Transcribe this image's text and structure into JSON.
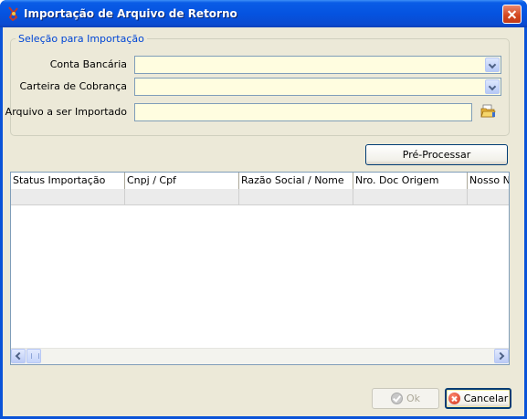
{
  "window": {
    "title": "Importação de Arquivo de Retorno",
    "icon": "app-logo-icon"
  },
  "selection": {
    "legend": "Seleção para Importação",
    "conta_bancaria_label": "Conta Bancária",
    "conta_bancaria_value": "",
    "carteira_label": "Carteira de Cobrança",
    "carteira_value": "",
    "arquivo_label": "Arquivo a ser Importado",
    "arquivo_value": ""
  },
  "buttons": {
    "preprocess": "Pré-Processar",
    "ok": "Ok",
    "cancel": "Cancelar"
  },
  "table": {
    "columns": [
      "Status Importação",
      "Cnpj / Cpf",
      "Razão Social / Nome",
      "Nro. Doc Origem",
      "Nosso Nú"
    ]
  },
  "colors": {
    "title_bar": "#0553e0",
    "window_bg": "#ece9d8",
    "input_bg": "#fffde0",
    "legend_text": "#0046d5"
  }
}
